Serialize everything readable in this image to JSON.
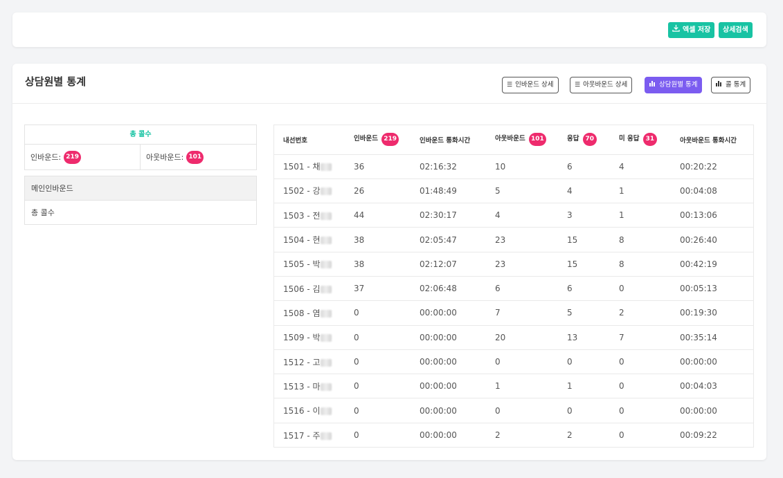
{
  "toolbar": {
    "excel_label": "엑셀 저장",
    "detail_search_label": "상세검색"
  },
  "page": {
    "title": "상담원별 통계",
    "tabs": [
      {
        "label": "인바운드 상세",
        "icon": "list-icon"
      },
      {
        "label": "아웃바운드 상세",
        "icon": "list-icon"
      },
      {
        "label": "상담원별 통계",
        "icon": "bar-chart-icon"
      },
      {
        "label": "콜 통계",
        "icon": "bar-chart-icon"
      }
    ],
    "active_tab": "상담원별 통계"
  },
  "summary": {
    "title": "총 콜수",
    "inbound_label": "인바운드:",
    "inbound_count": "219",
    "outbound_label": "아웃바운드:",
    "outbound_count": "101"
  },
  "main_inbound": {
    "header": "메인인바운드",
    "row_label": "총 콜수"
  },
  "table": {
    "headers": [
      "내선번호",
      "인바운드",
      "인바운드 통화시간",
      "아웃바운드",
      "응답",
      "미 응답",
      "아웃바운드 통화시간"
    ],
    "header_badges": {
      "inbound": "219",
      "outbound": "101",
      "answered": "70",
      "unanswered": "31"
    },
    "rows": [
      {
        "ext": "1501 - 채",
        "inbound": "36",
        "in_time": "02:16:32",
        "outbound": "10",
        "answered": "6",
        "unanswered": "4",
        "out_time": "00:20:22"
      },
      {
        "ext": "1502 - 강",
        "inbound": "26",
        "in_time": "01:48:49",
        "outbound": "5",
        "answered": "4",
        "unanswered": "1",
        "out_time": "00:04:08"
      },
      {
        "ext": "1503 - 전",
        "inbound": "44",
        "in_time": "02:30:17",
        "outbound": "4",
        "answered": "3",
        "unanswered": "1",
        "out_time": "00:13:06"
      },
      {
        "ext": "1504 - 현",
        "inbound": "38",
        "in_time": "02:05:47",
        "outbound": "23",
        "answered": "15",
        "unanswered": "8",
        "out_time": "00:26:40"
      },
      {
        "ext": "1505 - 박",
        "inbound": "38",
        "in_time": "02:12:07",
        "outbound": "23",
        "answered": "15",
        "unanswered": "8",
        "out_time": "00:42:19"
      },
      {
        "ext": "1506 - 김",
        "inbound": "37",
        "in_time": "02:06:48",
        "outbound": "6",
        "answered": "6",
        "unanswered": "0",
        "out_time": "00:05:13"
      },
      {
        "ext": "1508 - 염",
        "inbound": "0",
        "in_time": "00:00:00",
        "outbound": "7",
        "answered": "5",
        "unanswered": "2",
        "out_time": "00:19:30"
      },
      {
        "ext": "1509 - 박",
        "inbound": "0",
        "in_time": "00:00:00",
        "outbound": "20",
        "answered": "13",
        "unanswered": "7",
        "out_time": "00:35:14"
      },
      {
        "ext": "1512 - 고",
        "inbound": "0",
        "in_time": "00:00:00",
        "outbound": "0",
        "answered": "0",
        "unanswered": "0",
        "out_time": "00:00:00"
      },
      {
        "ext": "1513 - 마",
        "inbound": "0",
        "in_time": "00:00:00",
        "outbound": "1",
        "answered": "1",
        "unanswered": "0",
        "out_time": "00:04:03"
      },
      {
        "ext": "1516 - 이",
        "inbound": "0",
        "in_time": "00:00:00",
        "outbound": "0",
        "answered": "0",
        "unanswered": "0",
        "out_time": "00:00:00"
      },
      {
        "ext": "1517 - 주",
        "inbound": "0",
        "in_time": "00:00:00",
        "outbound": "2",
        "answered": "2",
        "unanswered": "0",
        "out_time": "00:09:22"
      }
    ]
  },
  "colors": {
    "accent_green": "#18c3a3",
    "active_tab": "#7b5cf0",
    "badge": "#ee2b6d"
  }
}
